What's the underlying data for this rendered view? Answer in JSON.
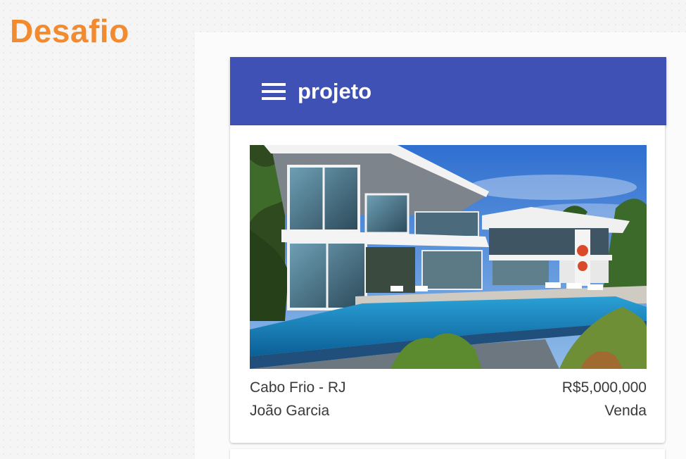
{
  "slide": {
    "title": "Desafio"
  },
  "app": {
    "title": "projeto",
    "menu_icon": "hamburger-menu-icon",
    "primary_color": "#3f51b5"
  },
  "property_card": {
    "image": "modern-house-with-pool-photo",
    "location": "Cabo Frio - RJ",
    "price": "R$5,000,000",
    "owner": "João Garcia",
    "type": "Venda"
  },
  "colors": {
    "slide_title": "#f28b30",
    "card_text": "#3a3a3a"
  }
}
